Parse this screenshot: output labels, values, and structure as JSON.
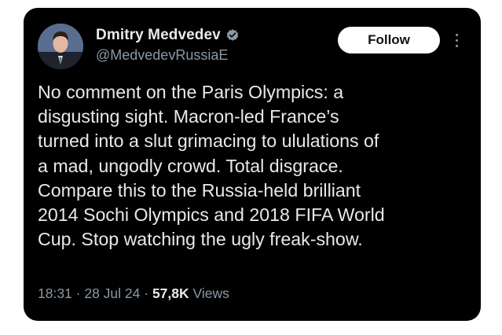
{
  "author": {
    "display_name": "Dmitry Medvedev",
    "handle": "@MedvedevRussiaE",
    "verified_icon": "verified-badge-icon",
    "verified_color": "#8b98a5"
  },
  "actions": {
    "follow_label": "Follow",
    "more_icon": "more-options-icon"
  },
  "tweet": {
    "text": "No comment on the Paris Olympics: a\ndisgusting sight. Macron-led France’s\nturned into a slut grimacing to ululations of\na mad, ungodly crowd. Total disgrace.\nCompare this to the Russia-held brilliant\n2014 Sochi Olympics and 2018 FIFA World\nCup. Stop watching the ugly freak-show."
  },
  "meta": {
    "time": "18:31",
    "separator": " · ",
    "date": "28 Jul 24",
    "views_count": "57,8K",
    "views_label": " Views"
  },
  "colors": {
    "card_background": "#000000",
    "text_primary": "#e7e9ea",
    "text_secondary": "#8b98a5",
    "button_background": "#ffffff"
  }
}
